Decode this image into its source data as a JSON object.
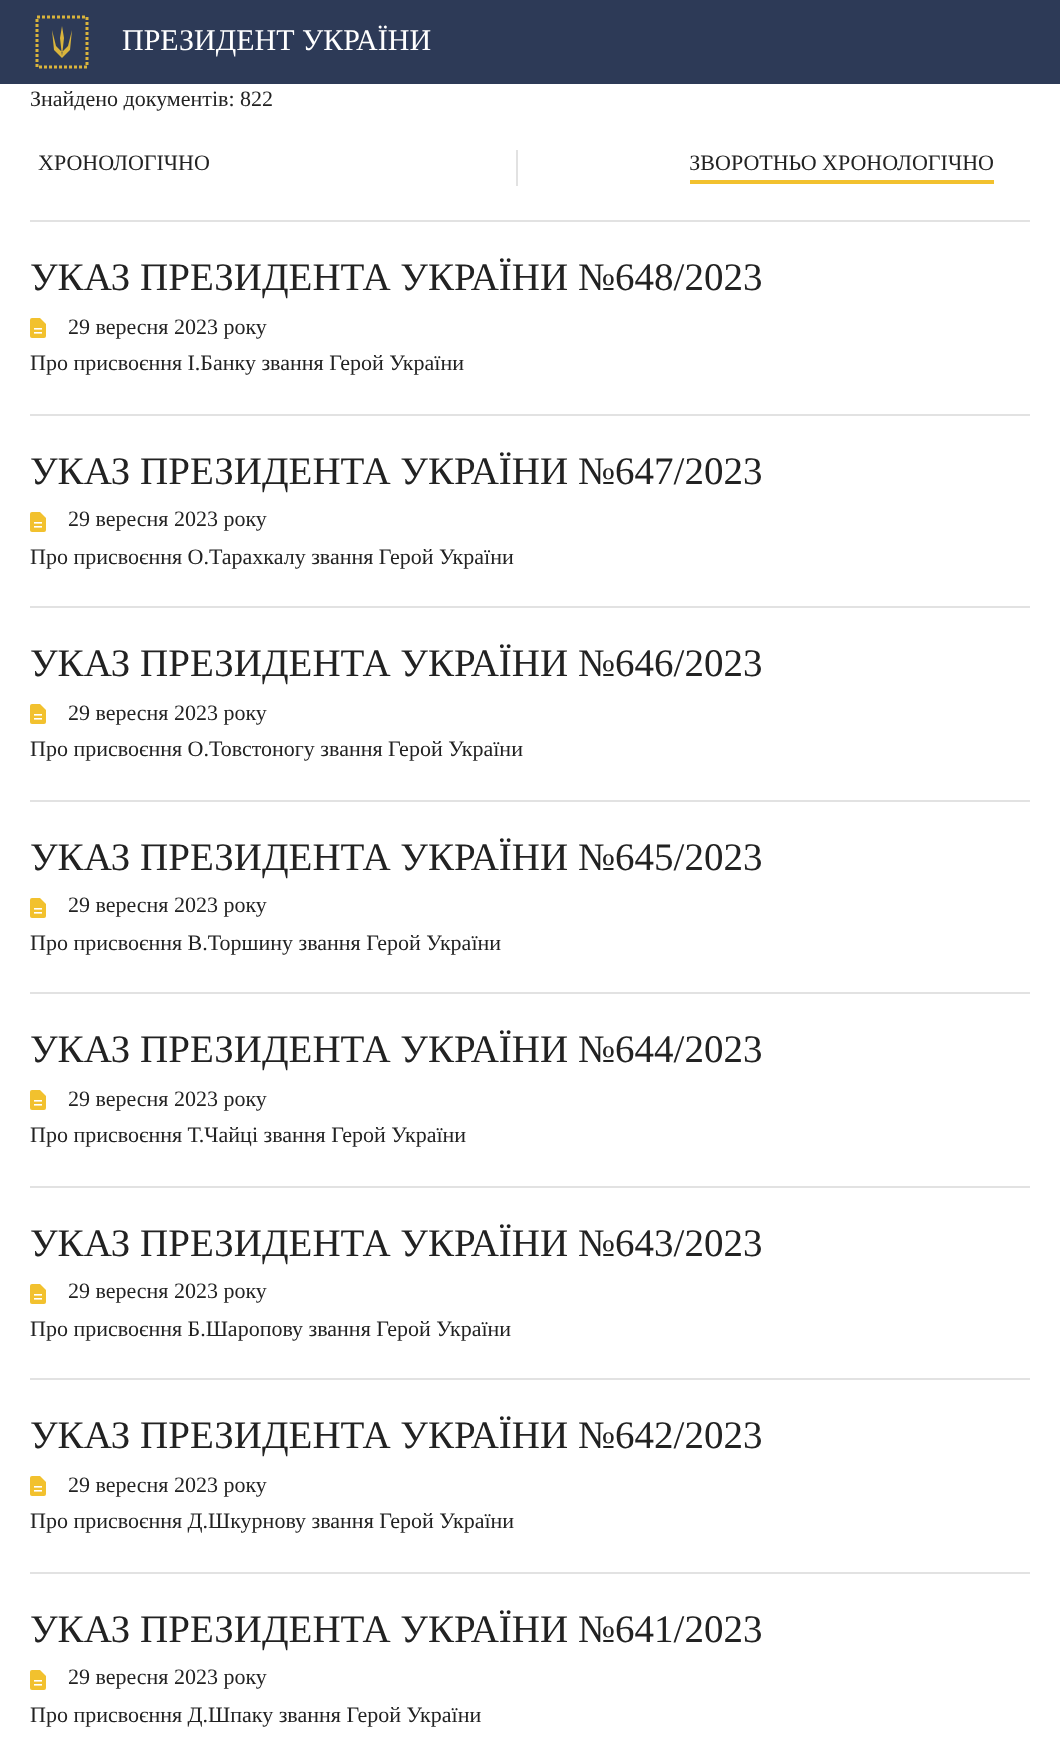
{
  "header": {
    "title": "ПРЕЗИДЕНТ УКРАЇНИ"
  },
  "found": "Знайдено документів: 822",
  "sort_tabs": [
    {
      "label": "ХРОНОЛОГІЧНО",
      "selected": false
    },
    {
      "label": "ЗВОРОТНЬО ХРОНОЛОГІЧНО",
      "selected": true
    }
  ],
  "documents": [
    {
      "title": "УКАЗ ПРЕЗИДЕНТА УКРАЇНИ №648/2023",
      "date": "29 вересня 2023 року",
      "summary": "Про присвоєння І.Банку звання Герой України"
    },
    {
      "title": "УКАЗ ПРЕЗИДЕНТА УКРАЇНИ №647/2023",
      "date": "29 вересня 2023 року",
      "summary": "Про присвоєння О.Тарахкалу звання Герой України"
    },
    {
      "title": "УКАЗ ПРЕЗИДЕНТА УКРАЇНИ №646/2023",
      "date": "29 вересня 2023 року",
      "summary": "Про присвоєння О.Товстоногу звання Герой України"
    },
    {
      "title": "УКАЗ ПРЕЗИДЕНТА УКРАЇНИ №645/2023",
      "date": "29 вересня 2023 року",
      "summary": "Про присвоєння В.Торшину звання Герой України"
    },
    {
      "title": "УКАЗ ПРЕЗИДЕНТА УКРАЇНИ №644/2023",
      "date": "29 вересня 2023 року",
      "summary": "Про присвоєння Т.Чайці звання Герой України"
    },
    {
      "title": "УКАЗ ПРЕЗИДЕНТА УКРАЇНИ №643/2023",
      "date": "29 вересня 2023 року",
      "summary": "Про присвоєння Б.Шаропову звання Герой України"
    },
    {
      "title": "УКАЗ ПРЕЗИДЕНТА УКРАЇНИ №642/2023",
      "date": "29 вересня 2023 року",
      "summary": "Про присвоєння Д.Шкурнову звання Герой України"
    },
    {
      "title": "УКАЗ ПРЕЗИДЕНТА УКРАЇНИ №641/2023",
      "date": "29 вересня 2023 року",
      "summary": "Про присвоєння Д.Шпаку звання Герой України"
    }
  ]
}
